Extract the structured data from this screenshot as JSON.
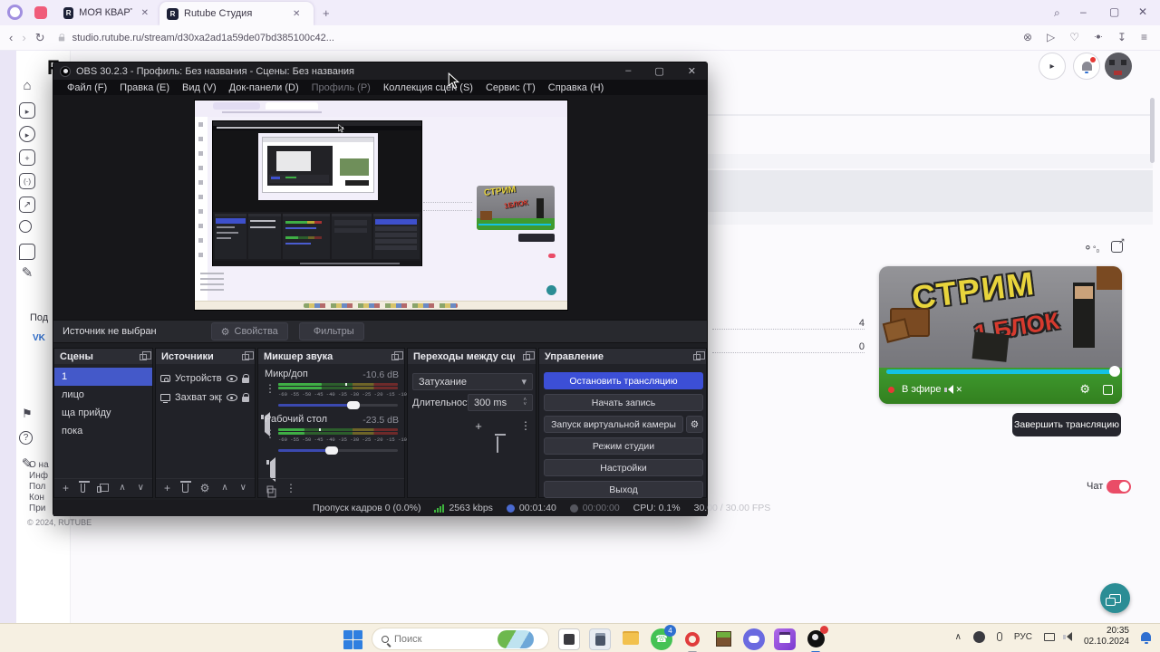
{
  "colors": {
    "obs_accent": "#3c4fd6",
    "obs_selection": "#4459c9",
    "meter_green": "#3fae45",
    "rutube_cyan": "#14c2e4",
    "toggle_red": "#ea4c67",
    "fab_teal": "#2b8d95",
    "live_red": "#e53935"
  },
  "browser": {
    "tab_inactive": "МОЯ КВАРТИРА В ВИРТУ...",
    "tab_active": "Rutube Студия",
    "favicon_letter": "R",
    "url": "studio.rutube.ru/stream/d30xa2ad1a59de07bd385100c42..."
  },
  "rutube": {
    "logo_fragment": "F",
    "subscribe_fragment": "Под",
    "vk_label": "VK",
    "stats": [
      {
        "value": "4"
      },
      {
        "value": "0"
      }
    ],
    "player": {
      "title_top": "СТРИМ",
      "title_bottom": "1 БЛОК",
      "live_label": "В эфире",
      "progress_pct": 99
    },
    "end_stream_button": "Завершить трансляцию",
    "chat_label": "Чат",
    "footer_links": [
      "О на",
      "Инф",
      "Пол",
      "Кон",
      "При"
    ],
    "copyright": "© 2024, RUTUBE"
  },
  "obs": {
    "title": "OBS 30.2.3 - Профиль: Без названия - Сцены: Без названия",
    "menu": [
      "Файл (F)",
      "Правка (E)",
      "Вид (V)",
      "Док-панели (D)",
      "Профиль (P)",
      "Коллекция сцен (S)",
      "Сервис (T)",
      "Справка (H)"
    ],
    "source_toolbar": {
      "status": "Источник не выбран",
      "properties": "Свойства",
      "filters": "Фильтры"
    },
    "scenes": {
      "title": "Сцены",
      "items": [
        "1",
        "лицо",
        "ща прийду",
        "пока"
      ],
      "selected_index": 0
    },
    "sources": {
      "title": "Источники",
      "items": [
        "Устройство з",
        "Захват экра"
      ]
    },
    "mixer": {
      "title": "Микшер звука",
      "channels": [
        {
          "name": "Микр/доп",
          "db": "-10.6 dB",
          "ruler": "-60 -55 -50 -45 -40 -35 -30 -25 -20 -15 -10 -5 0",
          "meter_pct": 36,
          "peak_pct": 56,
          "volume_pct": 63
        },
        {
          "name": "Рабочий стол",
          "db": "-23.5 dB",
          "ruler": "-60 -55 -50 -45 -40 -35 -30 -25 -20 -15 -10 -5 0",
          "meter_pct": 22,
          "peak_pct": 34,
          "volume_pct": 45
        }
      ]
    },
    "transitions": {
      "title": "Переходы между сцена...",
      "type": "Затухание",
      "duration_label": "Длительность",
      "duration_value": "300 ms"
    },
    "controls": {
      "title": "Управление",
      "buttons": [
        "Остановить трансляцию",
        "Начать запись",
        "Запуск виртуальной камеры",
        "Режим студии",
        "Настройки",
        "Выход"
      ]
    },
    "statusbar": {
      "dropped_frames": "Пропуск кадров 0 (0.0%)",
      "bitrate": "2563 kbps",
      "stream_time": "00:01:40",
      "record_time": "00:00:00",
      "cpu": "CPU: 0.1%",
      "fps": "30.00 / 30.00 FPS"
    }
  },
  "taskbar": {
    "search_placeholder": "Поиск",
    "whatsapp_badge": "4",
    "tray_lang": "РУС",
    "time": "20:35",
    "date": "02.10.2024"
  },
  "glyphs": {
    "gear": "⚙",
    "kebab": "⋮",
    "plus": "+",
    "up": "∧",
    "down": "∨",
    "dropdown_arrow": "▾",
    "spin_up": "˄",
    "spin_down": "˅",
    "close": "✕",
    "minimize": "–",
    "maximize": "▢",
    "back": "‹",
    "forward": "›",
    "reload": "↻",
    "heart": "♡",
    "send": "▷",
    "block": "⊗",
    "download": "↧",
    "menu": "≡",
    "home": "⌂",
    "flag": "⚑",
    "pencil": "✎",
    "question": "?",
    "arrow_up": "↗",
    "play": "▸",
    "mute_x": "✕"
  }
}
